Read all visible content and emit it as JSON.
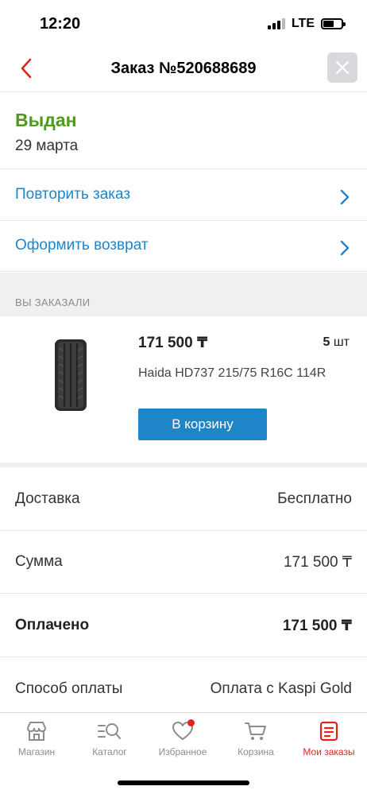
{
  "status_bar": {
    "time": "12:20",
    "network": "LTE"
  },
  "header": {
    "title": "Заказ №520688689"
  },
  "order_status": {
    "status": "Выдан",
    "date": "29 марта",
    "status_color": "#4e9b1c"
  },
  "actions": [
    {
      "label": "Повторить заказ"
    },
    {
      "label": "Оформить возврат"
    }
  ],
  "ordered_section": {
    "heading": "ВЫ ЗАКАЗАЛИ",
    "item": {
      "price": "171 500 ₸",
      "quantity": "5",
      "unit": "шт",
      "name": "Haida HD737 215/75 R16C 114R",
      "cart_button": "В корзину",
      "image_icon": "tire-icon"
    }
  },
  "summary": [
    {
      "label": "Доставка",
      "value": "Бесплатно"
    },
    {
      "label": "Сумма",
      "value": "171 500 ₸"
    },
    {
      "label": "Оплачено",
      "value": "171 500 ₸"
    },
    {
      "label": "Способ оплаты",
      "value": "Оплата с Kaspi Gold"
    }
  ],
  "tabbar": {
    "tabs": [
      {
        "label": "Магазин",
        "icon": "shop-icon"
      },
      {
        "label": "Каталог",
        "icon": "catalog-search-icon"
      },
      {
        "label": "Избранное",
        "icon": "heart-icon"
      },
      {
        "label": "Корзина",
        "icon": "cart-icon"
      },
      {
        "label": "Мои заказы",
        "icon": "orders-icon"
      }
    ],
    "active_tab": "Мои заказы"
  },
  "colors": {
    "accent_blue": "#1e86c8",
    "active_red": "#e2231a",
    "success_green": "#4e9b1c"
  }
}
